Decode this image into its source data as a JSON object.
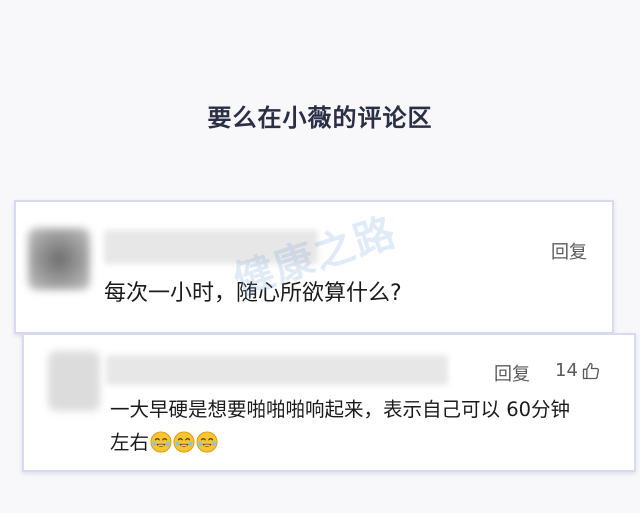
{
  "title": "要么在小薇的评论区",
  "comments": [
    {
      "reply_label": "回复",
      "text": "每次一小时，随心所欲算什么?"
    },
    {
      "reply_label": "回复",
      "likes": "14",
      "text": "一大早硬是想要啪啪啪响起来，表示自己可以 60分钟左右"
    }
  ],
  "watermark": {
    "text": "健康之路",
    "icon": "running-figure-icon"
  },
  "icons": {
    "like": "thumbs-up-icon",
    "emoji": "crying-laughing-emoji"
  },
  "colors": {
    "background": "#f8f8fa",
    "title": "#2a2f45",
    "card_border": "#d9daf0"
  }
}
